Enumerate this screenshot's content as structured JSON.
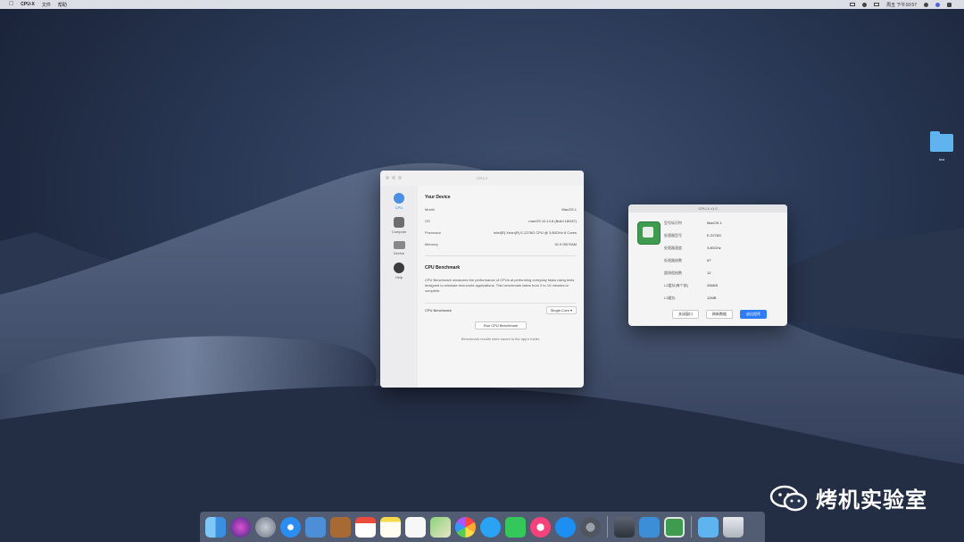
{
  "menubar": {
    "app_name": "CPU-X",
    "menu_file": "文件",
    "menu_help": "帮助",
    "clock": "周五 下午10:57"
  },
  "desktop": {
    "folder_label": "test"
  },
  "main_window": {
    "title": "CPU-X",
    "sidebar": [
      {
        "label": "CPU",
        "icon": "cpu-icon"
      },
      {
        "label": "Compute",
        "icon": "compute-icon"
      },
      {
        "label": "Device",
        "icon": "device-icon"
      },
      {
        "label": "Help",
        "icon": "help-icon"
      }
    ],
    "device_section_title": "Your Device",
    "device_rows": [
      {
        "key": "Model",
        "value": "MacOS.1"
      },
      {
        "key": "OS",
        "value": "macOS 10.14.6 (Build 18G87)"
      },
      {
        "key": "Processor",
        "value": "Intel(R) Xeon(R) E-2276G CPU @ 3.80GHz 6 Cores"
      },
      {
        "key": "Memory",
        "value": "32.0 GB RAM"
      }
    ],
    "bench_section_title": "CPU Benchmark",
    "bench_description": "CPU Benchmark measures the performance of CPUs at performing everyday tasks using tests designed to simulate real-world applications. This benchmark takes from 2 to 10 minutes to complete.",
    "bench_label": "CPU Benchmark",
    "bench_select": "Single-Core",
    "run_button": "Run CPU Benchmark",
    "footnote": "Benchmark results were saved to the app's folder."
  },
  "side_window": {
    "title": "CPU-X v1.0",
    "rows": [
      {
        "key": "型号标识符",
        "value": "MacOS.1"
      },
      {
        "key": "处理器型号",
        "value": "E-2276G"
      },
      {
        "key": "处理器速度",
        "value": "3.80GHz"
      },
      {
        "key": "处理器核数",
        "value": "6T"
      },
      {
        "key": "超线程核数",
        "value": "12"
      },
      {
        "key": "L2缓存(每个核)",
        "value": "256KB"
      },
      {
        "key": "L3缓存",
        "value": "12MB"
      }
    ],
    "btn_close": "关闭窗口",
    "btn_refresh": "刷新数据",
    "btn_quit": "退出程序"
  },
  "watermark": {
    "text": "烤机实验室"
  },
  "dock_items": [
    "finder-icon",
    "siri-icon",
    "launchpad-icon",
    "safari-icon",
    "mail-icon",
    "notes-book-icon",
    "calendar-icon",
    "notes-icon",
    "reminders-icon",
    "maps-icon",
    "photos-icon",
    "messages-icon",
    "facetime-icon",
    "music-icon",
    "appstore-icon",
    "settings-icon",
    "utility-icon",
    "xcode-icon",
    "cpu-x-icon",
    "downloads-folder-icon",
    "trash-icon"
  ]
}
